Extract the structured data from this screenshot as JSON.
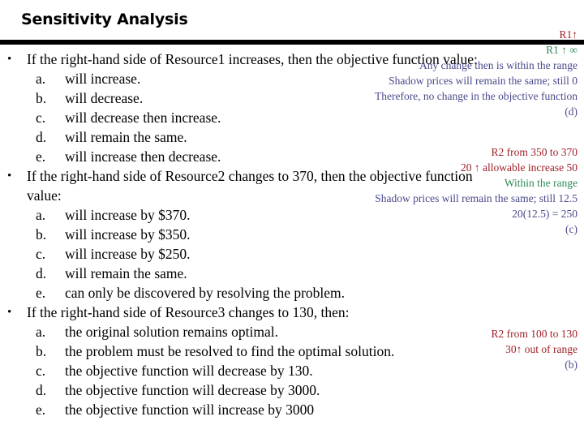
{
  "slide": {
    "title": "Sensitivity Analysis",
    "colors": {
      "red": "#a02028",
      "green": "#2e8b57",
      "navy": "#4a4a8c",
      "text": "#000000",
      "rule": "#000000",
      "background": "#ffffff"
    }
  },
  "questions": [
    {
      "bullet": "•",
      "lead": "If the right-hand side of Resource1 increases, then the objective function value:",
      "lead_cont": "",
      "options": [
        {
          "letter": "a.",
          "text": "will increase."
        },
        {
          "letter": "b.",
          "text": "will decrease."
        },
        {
          "letter": "c.",
          "text": "will decrease then increase."
        },
        {
          "letter": "d.",
          "text": "will remain the same."
        },
        {
          "letter": "e.",
          "text": "will increase then decrease."
        }
      ],
      "annotations": [
        {
          "text": "R1↑",
          "color": "red"
        },
        {
          "text": "R1 ↑ ∞",
          "color": "green"
        },
        {
          "text": "Any change then is within the range",
          "color": "navy"
        },
        {
          "text": "Shadow prices will remain the same; still 0",
          "color": "navy"
        },
        {
          "text": "Therefore, no change in the objective function",
          "color": "navy"
        },
        {
          "text": "(d)",
          "color": "navy"
        }
      ],
      "answer": "(d)"
    },
    {
      "bullet": "•",
      "lead": "If the right-hand side of Resource2 changes to 370, then the objective function",
      "lead_cont": "value:",
      "options": [
        {
          "letter": "a.",
          "text": "will increase by $370."
        },
        {
          "letter": "b.",
          "text": "will increase by $350."
        },
        {
          "letter": "c.",
          "text": "will increase by $250."
        },
        {
          "letter": "d.",
          "text": "will remain the same."
        },
        {
          "letter": "e.",
          "text": "can only be discovered by resolving the problem."
        }
      ],
      "annotations": [
        {
          "text": "R2 from 350 to 370",
          "color": "red"
        },
        {
          "text": "20 ↑ allowable increase 50",
          "color": "red"
        },
        {
          "text": "Within the range",
          "color": "green"
        },
        {
          "text": "Shadow prices will remain the same; still 12.5",
          "color": "navy"
        },
        {
          "text": "20(12.5) = 250",
          "color": "navy"
        },
        {
          "text": "(c)",
          "color": "navy"
        }
      ],
      "answer": "(c)"
    },
    {
      "bullet": "•",
      "lead": "If the right-hand side of Resource3 changes to 130, then:",
      "lead_cont": "",
      "options": [
        {
          "letter": "a.",
          "text": "the original solution remains optimal."
        },
        {
          "letter": "b.",
          "text": "the problem must be resolved to find the optimal solution."
        },
        {
          "letter": "c.",
          "text": "the objective function will decrease by 130."
        },
        {
          "letter": "d.",
          "text": "the objective function will decrease by 3000."
        },
        {
          "letter": "e.",
          "text": " the objective function will increase by 3000"
        }
      ],
      "annotations": [
        {
          "text": "R2 from 100 to 130",
          "color": "red"
        },
        {
          "text": "30↑ out of range",
          "color": "red"
        },
        {
          "text": "(b)",
          "color": "navy"
        }
      ],
      "answer": "(b)"
    }
  ]
}
